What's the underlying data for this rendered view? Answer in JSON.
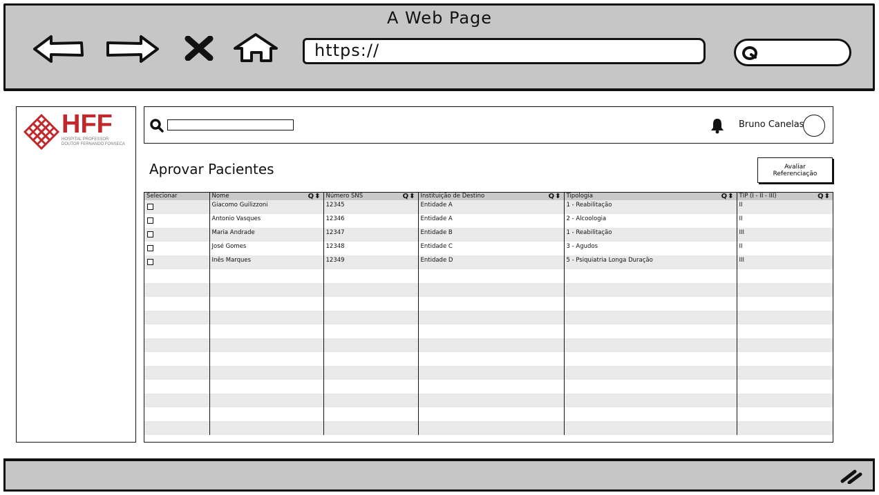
{
  "browser": {
    "title": "A Web Page",
    "url": "https://"
  },
  "logo": {
    "name": "HFF",
    "subtitle_line1": "HOSPITAL PROFESSOR",
    "subtitle_line2": "DOUTOR FERNANDO FONSECA",
    "color": "#c0282b"
  },
  "header": {
    "search_placeholder": "",
    "user_name": "Bruno Canelas"
  },
  "page": {
    "title": "Aprovar Pacientes",
    "evaluate_button": "Avaliar Referenciação"
  },
  "table": {
    "columns": [
      "Selecionar",
      "Nome",
      "Número SNS",
      "Instituição de Destino",
      "Tipologia",
      "TIP (I - II - III)"
    ],
    "sortable_icons": "Q⬍",
    "rows": [
      [
        "",
        "Giacomo Guilizzoni",
        "12345",
        "Entidade A",
        "1 - Reabilitação",
        "II"
      ],
      [
        "",
        "Antonio Vasques",
        "12346",
        "Entidade A",
        "2 - Alcoologia",
        "II"
      ],
      [
        "",
        "Maria Andrade",
        "12347",
        "Entidade B",
        "1 - Reabilitação",
        "III"
      ],
      [
        "",
        "José Gomes",
        "12348",
        "Entidade C",
        "3 - Agudos",
        "II"
      ],
      [
        "",
        "Inês Marques",
        "12349",
        "Entidade D",
        "5 - Psiquiatria Longa Duração",
        "III"
      ]
    ],
    "empty_rows": 12
  },
  "colors": {
    "chrome": "#c6c6c6",
    "header_row": "#c9c9c9",
    "stripe": "#eaeaea"
  }
}
